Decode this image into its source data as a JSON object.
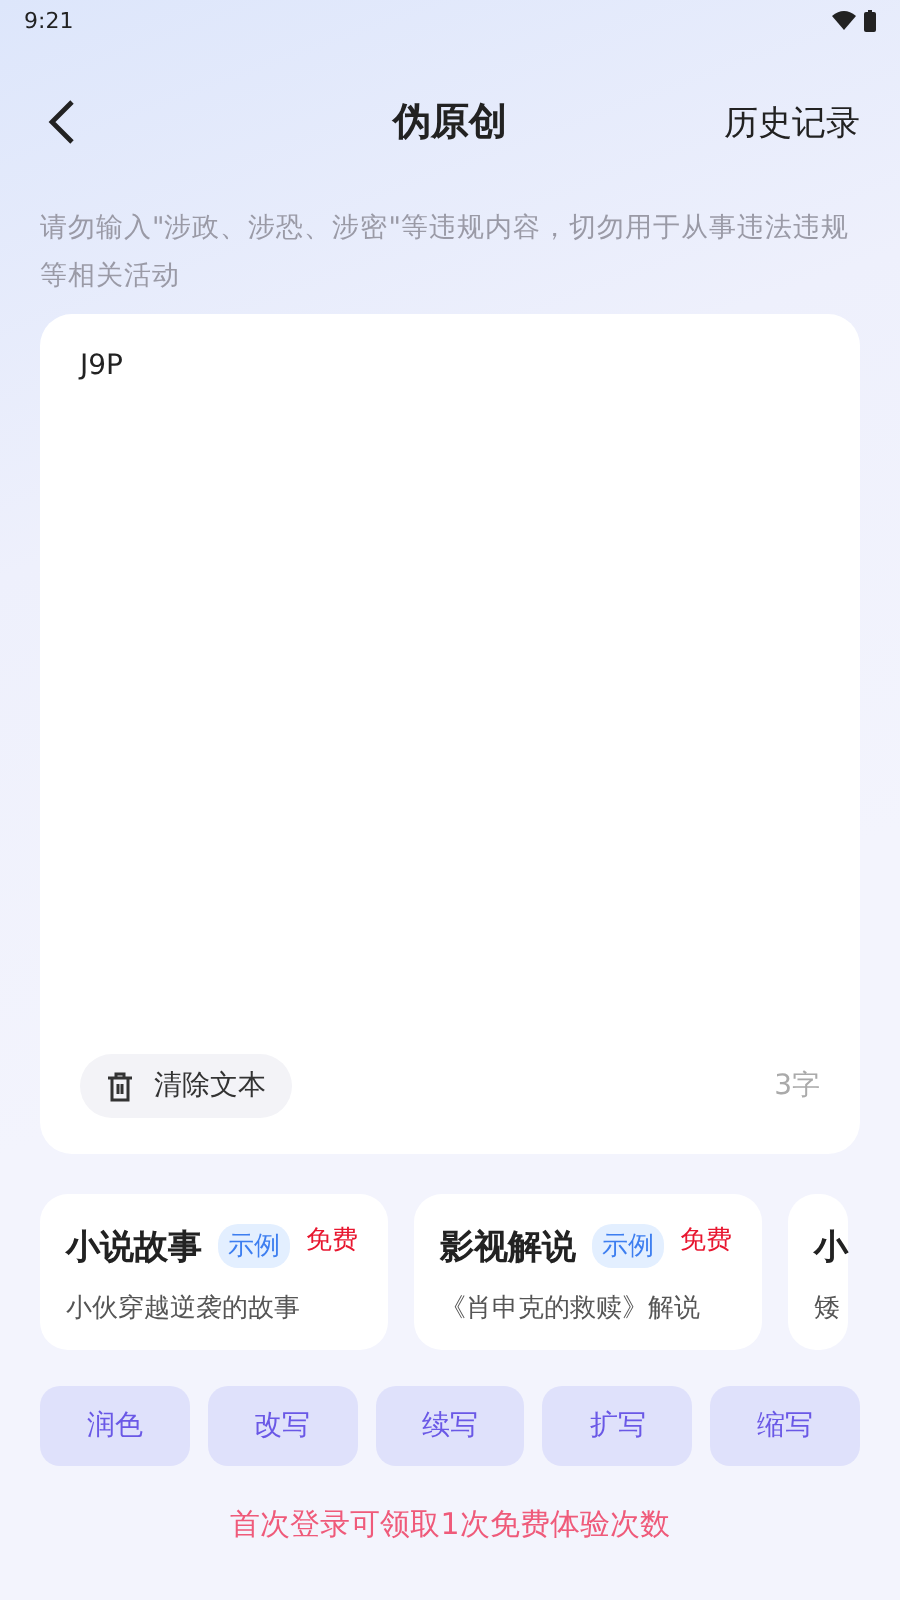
{
  "status_bar": {
    "time": "9:21"
  },
  "header": {
    "title": "伪原创",
    "action": "历史记录"
  },
  "notice": "请勿输入\"涉政、涉恐、涉密\"等违规内容，切勿用于从事违法违规等相关活动",
  "editor": {
    "value": "J9P",
    "clear_label": "清除文本",
    "count": "3字"
  },
  "examples": [
    {
      "title": "小说故事",
      "tag": "示例",
      "badge": "免费",
      "desc": "小伙穿越逆袭的故事"
    },
    {
      "title": "影视解说",
      "tag": "示例",
      "badge": "免费",
      "desc": "《肖申克的救赎》解说"
    },
    {
      "title": "小",
      "desc": "矮"
    }
  ],
  "actions": [
    "润色",
    "改写",
    "续写",
    "扩写",
    "缩写"
  ],
  "footer": "首次登录可领取1次免费体验次数"
}
